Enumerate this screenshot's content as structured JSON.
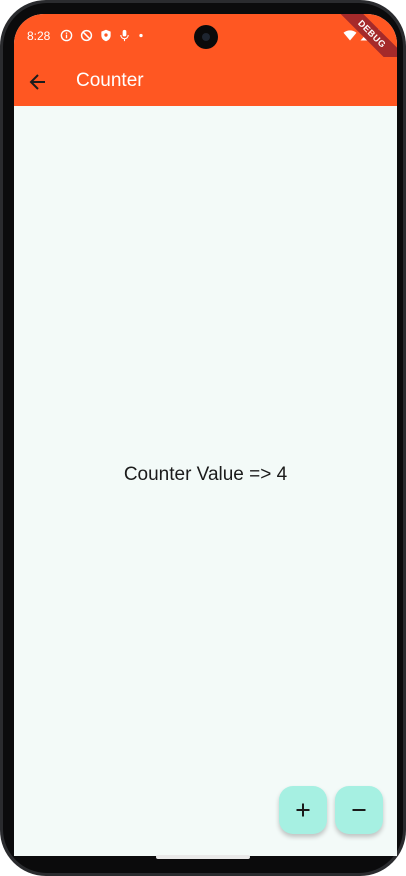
{
  "status_bar": {
    "time": "8:28",
    "icons_left": [
      "info-icon",
      "block-icon",
      "shield-icon",
      "mic-icon",
      "dot-icon"
    ],
    "icons_right": [
      "wifi-icon",
      "signal-icon",
      "battery-icon"
    ],
    "debug_label": "DEBUG",
    "background": "#ff5722"
  },
  "app_bar": {
    "title": "Counter",
    "back_icon": "arrow-back-icon",
    "background": "#ff5722"
  },
  "main": {
    "counter_text": "Counter Value => 4",
    "background": "#f3faf8"
  },
  "fabs": {
    "increment_icon": "plus-icon",
    "decrement_icon": "minus-icon",
    "color": "#a6f0e2"
  }
}
